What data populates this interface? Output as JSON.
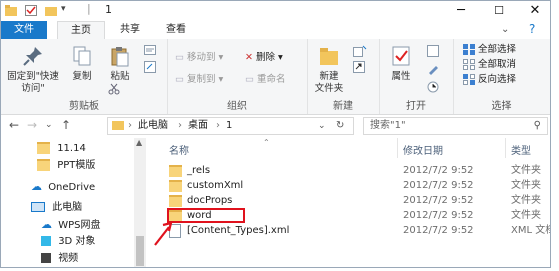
{
  "window": {
    "title": "1",
    "minimize": "─",
    "maximize": "☐",
    "close": "✕"
  },
  "ribbon_tabs": [
    "文件",
    "主页",
    "共享",
    "查看"
  ],
  "ribbon": {
    "clipboard": {
      "label": "剪贴板",
      "pin": "固定到\"快速访问\"",
      "copy": "复制",
      "paste": "粘贴"
    },
    "organize": {
      "label": "组织",
      "move_to": "移动到",
      "copy_to": "复制到",
      "delete": "删除",
      "rename": "重命名"
    },
    "new": {
      "label": "新建",
      "new_folder": "新建\n文件夹"
    },
    "open": {
      "label": "打开",
      "properties": "属性"
    },
    "select": {
      "label": "选择",
      "select_all": "全部选择",
      "select_none": "全部取消",
      "invert": "反向选择"
    }
  },
  "address": {
    "crumb1": "此电脑",
    "crumb2": "桌面",
    "crumb3": "1",
    "search_placeholder": "搜索\"1\""
  },
  "nav_items": [
    {
      "label": "11.14"
    },
    {
      "label": "PPT模版"
    },
    {
      "label": "OneDrive"
    },
    {
      "label": "此电脑"
    },
    {
      "label": "WPS网盘"
    },
    {
      "label": "3D 对象"
    },
    {
      "label": "视频"
    }
  ],
  "columns": {
    "name": "名称",
    "date": "修改日期",
    "type": "类型"
  },
  "files": [
    {
      "name": "_rels",
      "date": "2012/7/2 9:52",
      "type": "文件夹"
    },
    {
      "name": "customXml",
      "date": "2012/7/2 9:52",
      "type": "文件夹"
    },
    {
      "name": "docProps",
      "date": "2012/7/2 9:52",
      "type": "文件夹"
    },
    {
      "name": "word",
      "date": "2012/7/2 9:52",
      "type": "文件夹"
    },
    {
      "name": "[Content_Types].xml",
      "date": "2012/7/2 9:52",
      "type": "XML 文档"
    }
  ],
  "colors": {
    "accent": "#1979ca",
    "highlight": "#e0121d",
    "folder": "#f8d47a"
  }
}
